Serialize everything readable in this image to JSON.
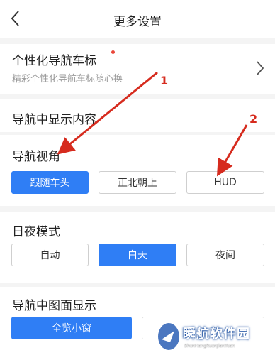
{
  "header": {
    "title": "更多设置"
  },
  "personal_marker": {
    "title": "个性化导航车标",
    "subtitle": "精彩个性化导航车标随心换"
  },
  "display_section": {
    "title": "导航中显示内容"
  },
  "view_section": {
    "title": "导航视角",
    "options": [
      {
        "label": "跟随车头",
        "active": true
      },
      {
        "label": "正北朝上",
        "active": false
      },
      {
        "label": "HUD",
        "active": false
      }
    ]
  },
  "daynight_section": {
    "title": "日夜模式",
    "options": [
      {
        "label": "自动",
        "active": false
      },
      {
        "label": "白天",
        "active": true
      },
      {
        "label": "夜间",
        "active": false
      }
    ]
  },
  "map_display_section": {
    "title": "导航中图面显示",
    "options": [
      {
        "label": "全览小窗",
        "active": true
      }
    ]
  },
  "annotations": {
    "arrow1": "1",
    "arrow2": "2"
  },
  "watermark": {
    "name": "瞬航软件园",
    "url": "ShunHangRuanJianYuan"
  },
  "colors": {
    "accent": "#2f7ef5",
    "annotation": "#d62b1e",
    "dot": "#e9463a"
  }
}
